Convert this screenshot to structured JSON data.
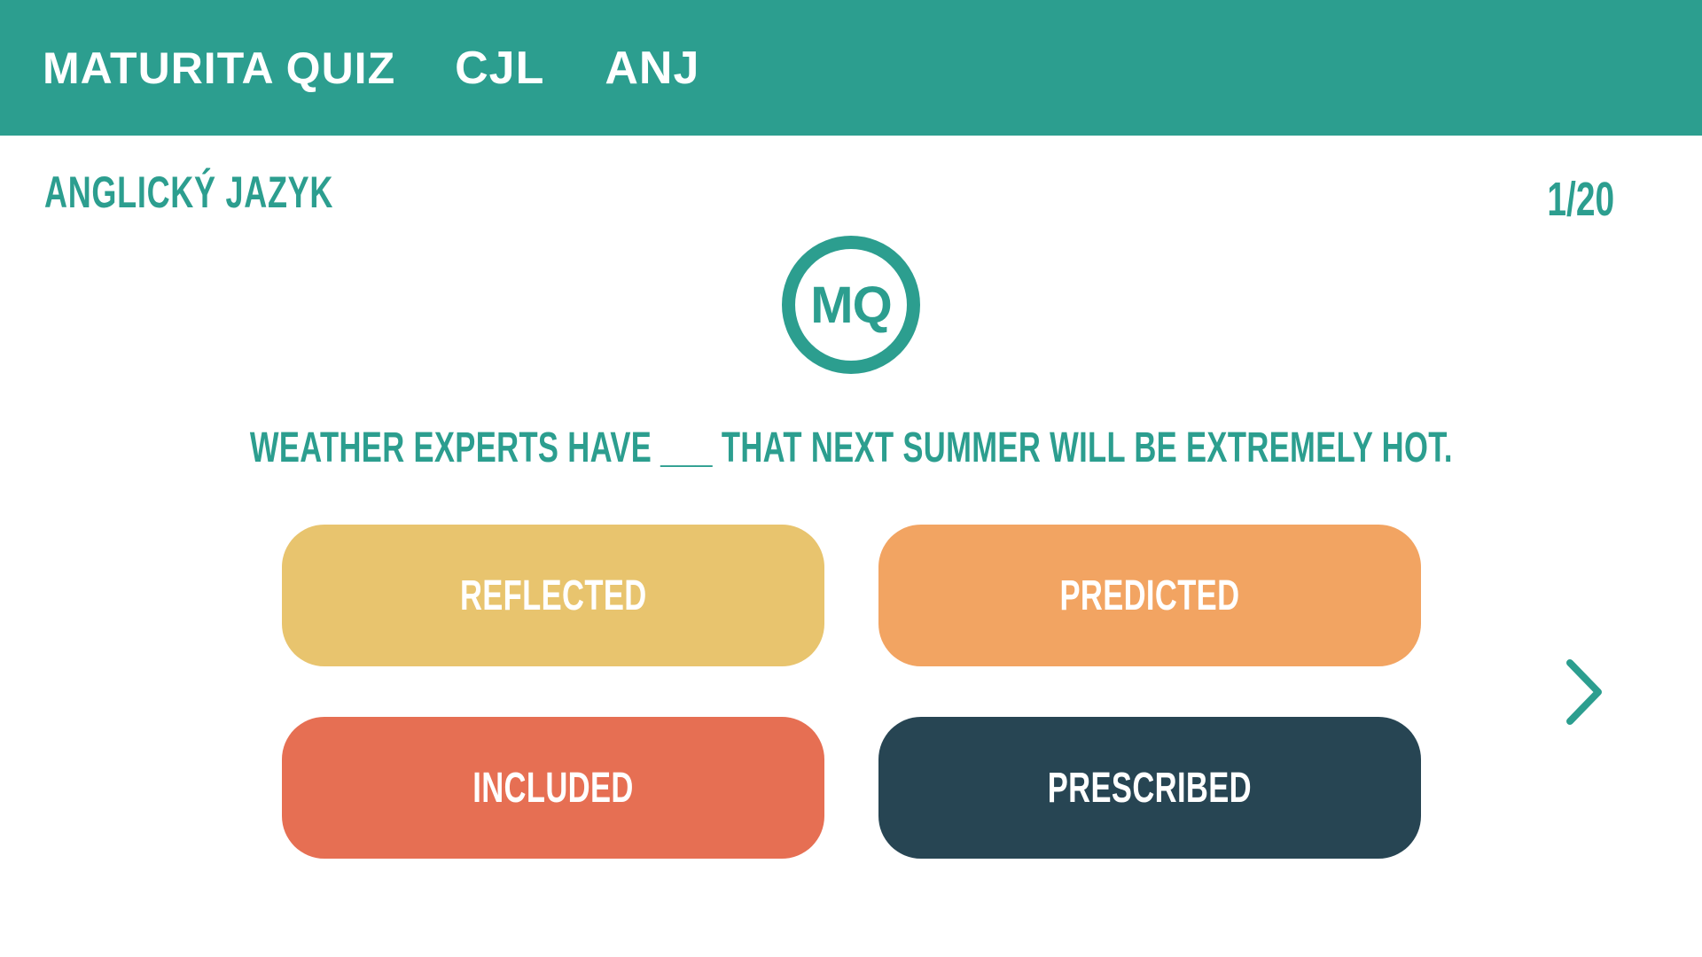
{
  "header": {
    "brand": "MATURITA QUIZ",
    "nav": [
      {
        "label": "CJL"
      },
      {
        "label": "ANJ"
      }
    ]
  },
  "quiz": {
    "subject": "ANGLICKÝ JAZYK",
    "progress": "1/20",
    "logo_text": "MQ",
    "question": "WEATHER EXPERTS HAVE ___ THAT NEXT SUMMER WILL BE EXTREMELY HOT.",
    "answers": [
      {
        "label": "REFLECTED",
        "color": "#e8c46e"
      },
      {
        "label": "PREDICTED",
        "color": "#f2a462"
      },
      {
        "label": "INCLUDED",
        "color": "#e66f53"
      },
      {
        "label": "PRESCRIBED",
        "color": "#274553"
      }
    ],
    "next_icon": "chevron-right-icon"
  },
  "colors": {
    "accent": "#2c9e8f",
    "background": "#ffffff"
  }
}
